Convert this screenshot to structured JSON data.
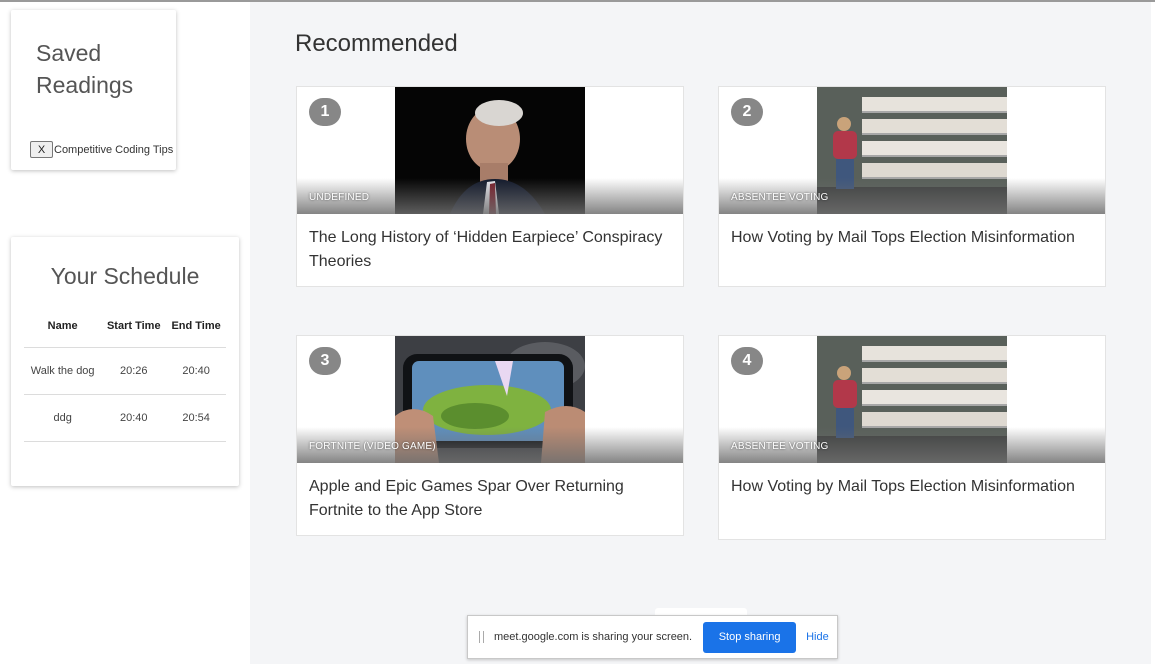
{
  "saved": {
    "title": "Saved Readings",
    "remove_label": "X",
    "items": [
      {
        "label": "Competitive Coding Tips"
      }
    ]
  },
  "schedule": {
    "title": "Your Schedule",
    "columns": [
      "Name",
      "Start Time",
      "End Time"
    ],
    "rows": [
      {
        "name": "Walk the dog",
        "start": "20:26",
        "end": "20:40"
      },
      {
        "name": "ddg",
        "start": "20:40",
        "end": "20:54"
      }
    ]
  },
  "main": {
    "title": "Recommended",
    "articles": [
      {
        "num": "1",
        "tag": "undefined",
        "headline": "The Long History of ‘Hidden Earpiece’ Conspiracy Theories",
        "image": "portrait-photo"
      },
      {
        "num": "2",
        "tag": "absentee voting",
        "headline": "How Voting by Mail Tops Election Misinformation",
        "image": "mail-ballots-photo"
      },
      {
        "num": "3",
        "tag": "Fortnite (Video Game)",
        "headline": "Apple and Epic Games Spar Over Returning Fortnite to the App Store",
        "image": "phone-game-photo"
      },
      {
        "num": "4",
        "tag": "absentee voting",
        "headline": "How Voting by Mail Tops Election Misinformation",
        "image": "mail-ballots-photo"
      }
    ]
  },
  "share_bar": {
    "message": "meet.google.com is sharing your screen.",
    "stop_label": "Stop sharing",
    "hide_label": "Hide"
  },
  "colors": {
    "accent": "#1a73e8",
    "badge": "#878787",
    "background": "#f4f5f7"
  }
}
